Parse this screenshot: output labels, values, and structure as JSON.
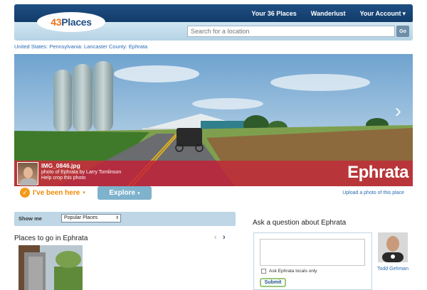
{
  "brand": {
    "logo_num": "43",
    "logo_word": "Places"
  },
  "topnav": {
    "items": [
      {
        "label": "Your 36 Places",
        "caret": ""
      },
      {
        "label": "Wanderlust",
        "caret": ""
      },
      {
        "label": "Your Account",
        "caret": "▾"
      }
    ]
  },
  "search": {
    "placeholder": "Search for a location",
    "go_label": "Go"
  },
  "breadcrumb": "United States: Pennsylvania: Lancaster County: Ephrata",
  "hero": {
    "filename": "IMG_0846.jpg",
    "credit": "photo of Ephrata by Larry Tomlinson",
    "crop_link": "Help crop this photo",
    "place_name": "Ephrata",
    "next_icon": "›"
  },
  "actions": {
    "been_here_label": "I've been here",
    "been_here_caret": "▾",
    "check_icon": "✓",
    "explore_label": "Explore",
    "explore_caret": "▾",
    "upload_link": "Upload a photo of this place"
  },
  "show_me": {
    "label": "Show me",
    "selected": "Popular Places",
    "select_arrow": "⇕"
  },
  "places": {
    "heading": "Places to go in Ephrata",
    "prev_icon": "‹",
    "next_icon": "›"
  },
  "ask": {
    "heading": "Ask a question about Ephrata",
    "checkbox_label": "Ask Ephrata locals only",
    "submit_label": "Submit",
    "user_name": "Todd Gehman"
  },
  "colors": {
    "nav_dark": "#113a68",
    "caption_red": "#c41e34",
    "accent_orange": "#f08a0a",
    "link_blue": "#2a6bb4"
  }
}
